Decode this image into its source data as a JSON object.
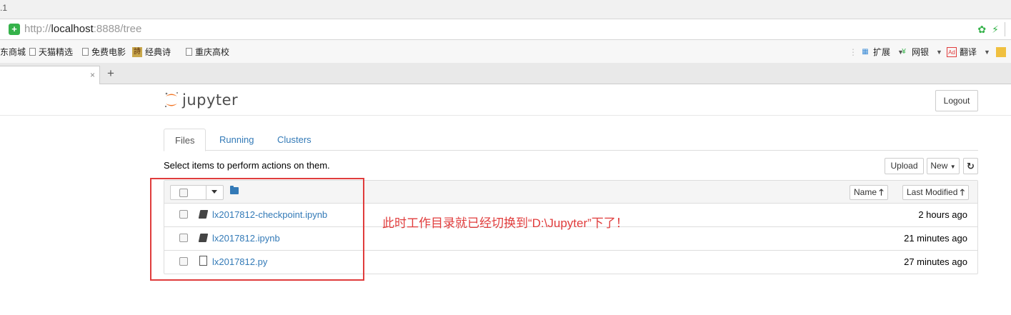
{
  "browser": {
    "title_fragment": ".1",
    "address": {
      "scheme": "http://",
      "host": "localhost",
      "port_path": ":8888/tree"
    },
    "bookmarks": [
      "东商城",
      "天猫精选",
      "免费电影",
      "经典诗",
      "重庆高校"
    ],
    "extensions": [
      "扩展",
      "网银",
      "翻译"
    ],
    "tab_close": "×",
    "new_tab": "+"
  },
  "header": {
    "logo_text": "jupyter",
    "logout_label": "Logout"
  },
  "tabs": [
    {
      "label": "Files",
      "active": true
    },
    {
      "label": "Running",
      "active": false
    },
    {
      "label": "Clusters",
      "active": false
    }
  ],
  "toolbar": {
    "hint": "Select items to perform actions on them.",
    "upload_label": "Upload",
    "new_label": "New",
    "refresh_icon": "refresh-icon"
  },
  "list": {
    "sort_name_label": "Name",
    "sort_modified_label": "Last Modified",
    "files": [
      {
        "name": "lx2017812-checkpoint.ipynb",
        "type": "notebook",
        "modified": "2 hours ago"
      },
      {
        "name": "lx2017812.ipynb",
        "type": "notebook",
        "modified": "21 minutes ago"
      },
      {
        "name": "lx2017812.py",
        "type": "file",
        "modified": "27 minutes ago"
      }
    ]
  },
  "annotation": {
    "text": "此时工作目录就已经切换到“D:\\Jupyter”下了！",
    "color": "#e03c3c"
  },
  "colors": {
    "link": "#337ab7",
    "jupyter_orange": "#f37726",
    "secure_green": "#35b24a"
  }
}
